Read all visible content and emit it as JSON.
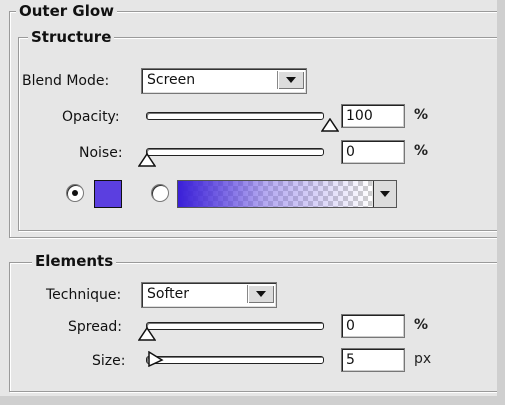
{
  "outer_glow": {
    "title": "Outer Glow",
    "structure": {
      "title": "Structure",
      "blend_mode_label": "Blend Mode:",
      "blend_mode_value": "Screen",
      "opacity_label": "Opacity:",
      "opacity_value": "100",
      "opacity_unit": "%",
      "opacity_level": 1.0,
      "noise_label": "Noise:",
      "noise_value": "0",
      "noise_unit": "%",
      "noise_level": 0.0,
      "color_swatch": "#5b3fe0",
      "gradient_start": "#3a1fd8"
    },
    "elements": {
      "title": "Elements",
      "technique_label": "Technique:",
      "technique_value": "Softer",
      "spread_label": "Spread:",
      "spread_value": "0",
      "spread_unit": "%",
      "spread_level": 0.0,
      "size_label": "Size:",
      "size_value": "5",
      "size_unit": "px"
    }
  },
  "icons": {
    "dropdown_arrow": "chevron-down-icon",
    "slider_thumb": "triangle-thumb-icon"
  }
}
